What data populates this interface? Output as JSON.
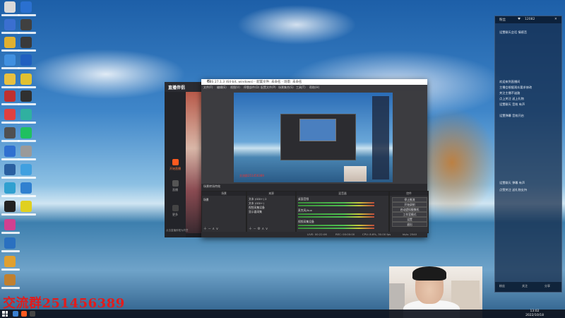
{
  "watermark": "交流群251456389",
  "taskbar": {
    "time": "13:02",
    "date": "2022/10/18"
  },
  "live_app": {
    "logo": "直播伴侣",
    "side_items": [
      "开始直播",
      "直播",
      "更多"
    ],
    "footer": "点击直播即视为同意"
  },
  "obs": {
    "title": "OBS 27.1.3 (64-bit, windows) - 配置文件: 未命名 - 场景: 未命名",
    "menu": [
      "文件(F)",
      "编辑(E)",
      "视图(V)",
      "停靠部件(D)",
      "配置文件(P)",
      "场景集合(S)",
      "工具(T)",
      "帮助(H)"
    ],
    "preview_text": "交流群251456389",
    "docks": {
      "scenes": {
        "header": "场景",
        "items": [
          "场景"
        ]
      },
      "sources": {
        "header": "来源",
        "items": [
          "文本 (GDI+) 2",
          "文本 (GDI+)",
          "视频采集设备",
          "显示器采集"
        ]
      },
      "mixer": {
        "header": "混音器",
        "channels": [
          "桌面音频",
          "麦克风/Aux",
          "视频采集设备"
        ]
      },
      "controls": {
        "header": "控件",
        "buttons": [
          "停止推流",
          "开始录制",
          "启动虚拟摄像机",
          "工作室模式",
          "设置",
          "退出"
        ]
      }
    },
    "footer": {
      "live": "LIVE: 00:22:06",
      "rec": "REC: 00:00:00",
      "cpu": "CPU: 8.6%, 30.00 fps",
      "kb": "kb/s: 2540"
    },
    "transitions": "转场特效",
    "stats_label": "场景转场特效"
  },
  "chat": {
    "header": [
      "粉丝",
      "12082"
    ],
    "lines": [
      "设置聊天会话 情感音",
      "",
      "欢迎来到直播间",
      "主播会根据观众要求修改",
      "关注主播不迷路",
      "点上关注 送上礼物",
      "设置聊天 音效 有声",
      "设置弹幕 音效开启",
      "",
      "",
      "设置聊天 弹幕 有声",
      "点赞关注 送礼物支持"
    ],
    "footer": [
      "粉丝",
      "关注",
      "分享"
    ]
  },
  "colors": {
    "accent": "#e31b1b",
    "obs_bg": "#2b2b2f",
    "live_accent": "#ff5a1f"
  }
}
